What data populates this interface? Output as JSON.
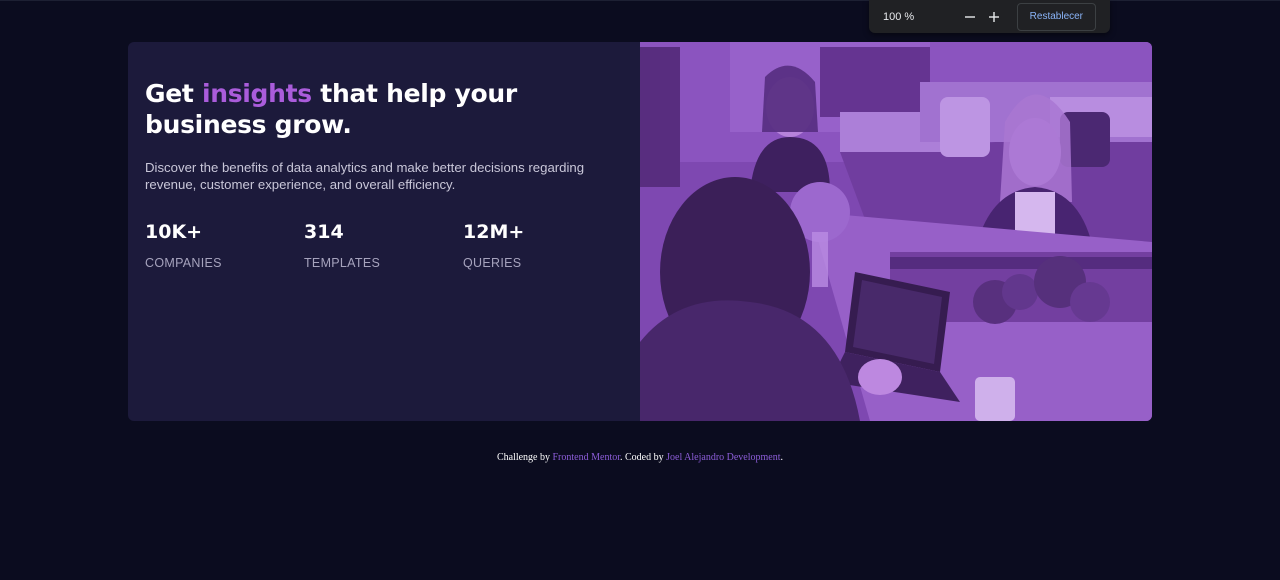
{
  "browser_zoom": {
    "level": "100 %",
    "minus_icon": "minus-icon",
    "plus_icon": "plus-icon",
    "reset_label": "Restablecer"
  },
  "card": {
    "headline_start": "Get ",
    "headline_accent": "insights",
    "headline_end": " that help your business grow.",
    "description": "Discover the benefits of data analytics and make better decisions regarding revenue, customer experience, and overall efficiency.",
    "stats": [
      {
        "value": "10K+",
        "label": "COMPANIES"
      },
      {
        "value": "314",
        "label": "TEMPLATES"
      },
      {
        "value": "12M+",
        "label": "QUERIES"
      }
    ]
  },
  "attribution": {
    "prefix": "Challenge by ",
    "challenge_link": "Frontend Mentor",
    "middle": ". Coded by ",
    "author_link": "Joel Alejandro Development",
    "suffix": "."
  },
  "colors": {
    "page_background": "#0b0c1f",
    "card_background": "#1c1a3b",
    "accent": "#aa5cdb",
    "image_overlay": "#8d4dc8",
    "link": "#8c5dd8",
    "zoom_reset_text": "#8ab4f8"
  }
}
